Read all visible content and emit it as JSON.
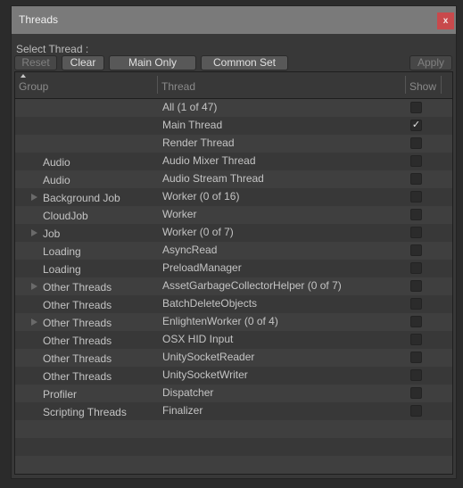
{
  "window": {
    "title": "Threads",
    "close_label": "x"
  },
  "select_label": "Select Thread :",
  "toolbar": {
    "reset_label": "Reset",
    "clear_label": "Clear",
    "main_only_label": "Main Only",
    "common_set_label": "Common Set",
    "apply_label": "Apply"
  },
  "table": {
    "headers": {
      "group": "Group",
      "thread": "Thread",
      "show": "Show"
    },
    "rows": [
      {
        "group": "",
        "thread": "All (1 of 47)",
        "expandable": false,
        "checked": false
      },
      {
        "group": "",
        "thread": "Main Thread",
        "expandable": false,
        "checked": true
      },
      {
        "group": "",
        "thread": "Render Thread",
        "expandable": false,
        "checked": false
      },
      {
        "group": "Audio",
        "thread": "Audio Mixer Thread",
        "expandable": false,
        "checked": false
      },
      {
        "group": "Audio",
        "thread": "Audio Stream Thread",
        "expandable": false,
        "checked": false
      },
      {
        "group": "Background Job",
        "thread": "Worker (0 of 16)",
        "expandable": true,
        "checked": false
      },
      {
        "group": "CloudJob",
        "thread": "Worker",
        "expandable": false,
        "checked": false
      },
      {
        "group": "Job",
        "thread": "Worker (0 of 7)",
        "expandable": true,
        "checked": false
      },
      {
        "group": "Loading",
        "thread": "AsyncRead",
        "expandable": false,
        "checked": false
      },
      {
        "group": "Loading",
        "thread": "PreloadManager",
        "expandable": false,
        "checked": false
      },
      {
        "group": "Other Threads",
        "thread": "AssetGarbageCollectorHelper (0 of 7)",
        "expandable": true,
        "checked": false
      },
      {
        "group": "Other Threads",
        "thread": "BatchDeleteObjects",
        "expandable": false,
        "checked": false
      },
      {
        "group": "Other Threads",
        "thread": "EnlightenWorker (0 of 4)",
        "expandable": true,
        "checked": false
      },
      {
        "group": "Other Threads",
        "thread": "OSX HID Input",
        "expandable": false,
        "checked": false
      },
      {
        "group": "Other Threads",
        "thread": "UnitySocketReader",
        "expandable": false,
        "checked": false
      },
      {
        "group": "Other Threads",
        "thread": "UnitySocketWriter",
        "expandable": false,
        "checked": false
      },
      {
        "group": "Profiler",
        "thread": "Dispatcher",
        "expandable": false,
        "checked": false
      },
      {
        "group": "Scripting Threads",
        "thread": "Finalizer",
        "expandable": false,
        "checked": false
      }
    ],
    "empty_rows": 3,
    "check_glyph": "✓"
  }
}
